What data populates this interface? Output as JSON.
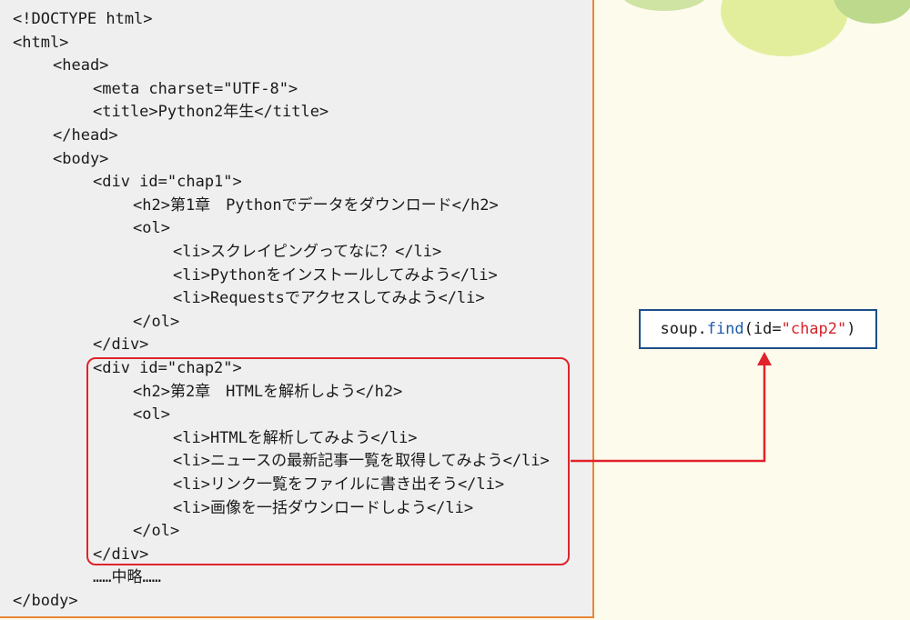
{
  "code_lines": [
    {
      "text": "<!DOCTYPE html>",
      "indent": 0
    },
    {
      "text": "<html>",
      "indent": 0
    },
    {
      "text": "<head>",
      "indent": 1
    },
    {
      "text": "<meta charset=\"UTF-8\">",
      "indent": 2
    },
    {
      "text": "<title>Python2年生</title>",
      "indent": 2
    },
    {
      "text": "</head>",
      "indent": 1
    },
    {
      "text": "<body>",
      "indent": 1
    },
    {
      "text": "<div id=\"chap1\">",
      "indent": 2
    },
    {
      "text": "<h2>第1章　Pythonでデータをダウンロード</h2>",
      "indent": 3
    },
    {
      "text": "<ol>",
      "indent": 3
    },
    {
      "text": "<li>スクレイピングってなに？</li>",
      "indent": 4
    },
    {
      "text": "<li>Pythonをインストールしてみよう</li>",
      "indent": 4
    },
    {
      "text": "<li>Requestsでアクセスしてみよう</li>",
      "indent": 4
    },
    {
      "text": "</ol>",
      "indent": 3
    },
    {
      "text": "</div>",
      "indent": 2
    },
    {
      "text": "<div id=\"chap2\">",
      "indent": 2
    },
    {
      "text": "<h2>第2章　HTMLを解析しよう</h2>",
      "indent": 3
    },
    {
      "text": "<ol>",
      "indent": 3
    },
    {
      "text": "<li>HTMLを解析してみよう</li>",
      "indent": 4
    },
    {
      "text": "<li>ニュースの最新記事一覧を取得してみよう</li>",
      "indent": 4
    },
    {
      "text": "<li>リンク一覧をファイルに書き出そう</li>",
      "indent": 4
    },
    {
      "text": "<li>画像を一括ダウンロードしよう</li>",
      "indent": 4
    },
    {
      "text": "</ol>",
      "indent": 3
    },
    {
      "text": "</div>",
      "indent": 2
    },
    {
      "text": "……中略……",
      "indent": 2
    },
    {
      "text": "</body>",
      "indent": 0
    }
  ],
  "callout": {
    "object": "soup.",
    "method": "find",
    "args_open": "(id=",
    "arg_value": "\"chap2\"",
    "args_close": ")"
  },
  "colors": {
    "highlight": "#e0232b",
    "panel_border": "#e8873a",
    "callout_border": "#1d4f8a",
    "method": "#1f5aa8",
    "string": "#d6232b"
  }
}
